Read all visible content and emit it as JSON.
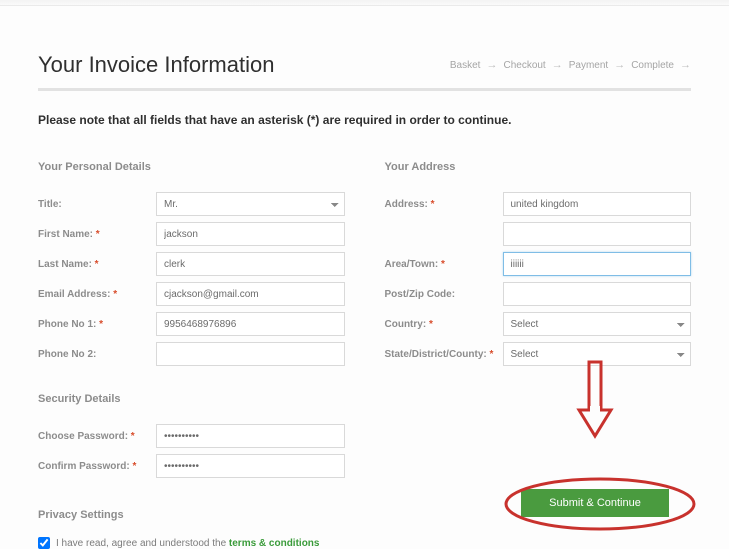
{
  "header": {
    "title": "Your Invoice Information",
    "crumbs": [
      "Basket",
      "Checkout",
      "Payment",
      "Complete"
    ]
  },
  "note": "Please note that all fields that have an asterisk (*) are required in order to continue.",
  "personal": {
    "section": "Your Personal Details",
    "title_label": "Title:",
    "title_value": "Mr.",
    "first_label": "First Name:",
    "first_value": "jackson",
    "last_label": "Last Name:",
    "last_value": "clerk",
    "email_label": "Email Address:",
    "email_value": "cjackson@gmail.com",
    "phone1_label": "Phone No 1:",
    "phone1_value": "9956468976896",
    "phone2_label": "Phone No 2:",
    "phone2_value": ""
  },
  "address": {
    "section": "Your Address",
    "addr_label": "Address:",
    "addr_value": "united kingdom",
    "addr2_value": "",
    "area_label": "Area/Town:",
    "area_value": "iiiiii",
    "post_label": "Post/Zip Code:",
    "post_value": "",
    "country_label": "Country:",
    "country_value": "Select",
    "state_label": "State/District/County:",
    "state_value": "Select"
  },
  "security": {
    "section": "Security Details",
    "choose_label": "Choose Password:",
    "choose_value": "••••••••••",
    "confirm_label": "Confirm Password:",
    "confirm_value": "••••••••••"
  },
  "privacy": {
    "section": "Privacy Settings",
    "check_text": "I have read, agree and understood the ",
    "terms_text": "terms & conditions"
  },
  "submit": "Submit & Continue",
  "asterisk": " *"
}
